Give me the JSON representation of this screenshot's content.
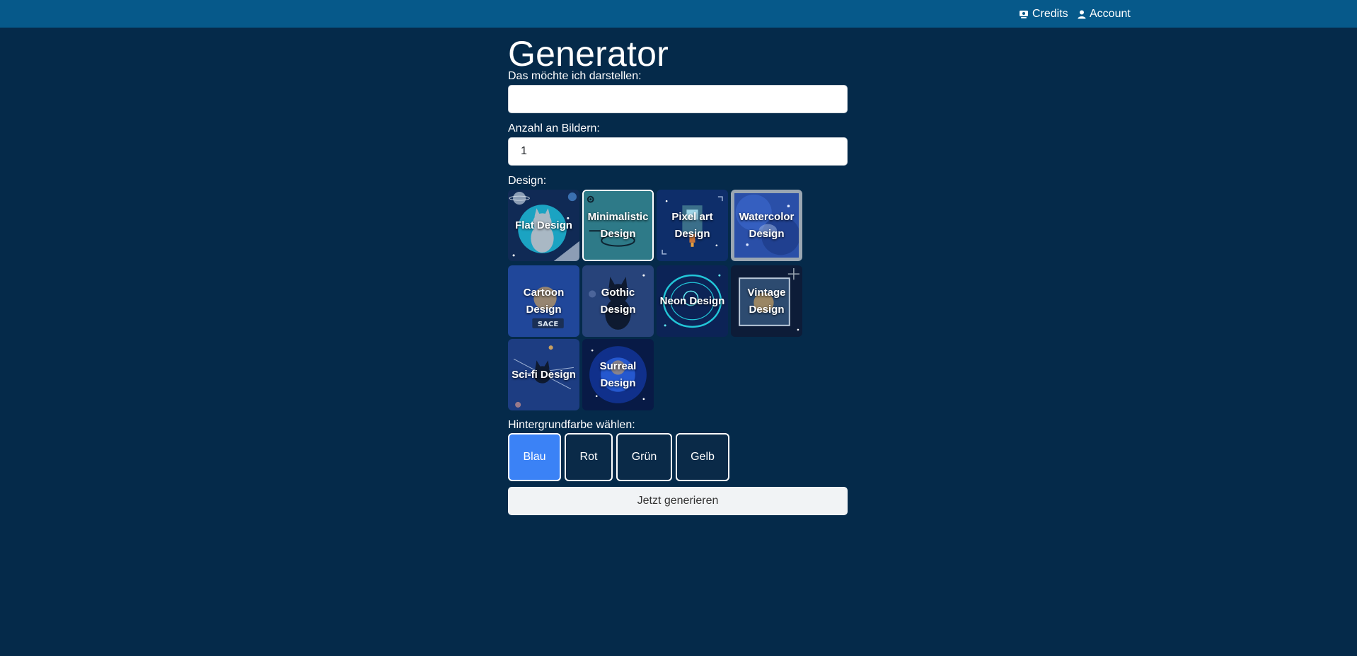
{
  "nav": {
    "credits": "Credits",
    "account": "Account"
  },
  "page": {
    "title": "Generator"
  },
  "form": {
    "prompt_label": "Das möchte ich darstellen:",
    "prompt_value": "",
    "count_label": "Anzahl an Bildern:",
    "count_value": "1",
    "design_label": "Design:",
    "designs": [
      {
        "label": "Flat Design"
      },
      {
        "label": "Minimalistic Design",
        "selected": true
      },
      {
        "label": "Pixel art Design"
      },
      {
        "label": "Watercolor Design",
        "selected": true
      },
      {
        "label": "Cartoon Design"
      },
      {
        "label": "Gothic Design"
      },
      {
        "label": "Neon Design"
      },
      {
        "label": "Vintage Design"
      },
      {
        "label": "Sci-fi Design"
      },
      {
        "label": "Surreal Design"
      }
    ],
    "bg_label": "Hintergrundfarbe wählen:",
    "colors": [
      {
        "label": "Blau",
        "active": true
      },
      {
        "label": "Rot"
      },
      {
        "label": "Grün"
      },
      {
        "label": "Gelb"
      }
    ],
    "generate_label": "Jetzt generieren"
  },
  "icons": {
    "credits": "credits-icon",
    "account": "person-icon"
  },
  "colors": {
    "background": "#052a4a",
    "topbar": "#06598a",
    "active_button": "#3b82f6"
  }
}
